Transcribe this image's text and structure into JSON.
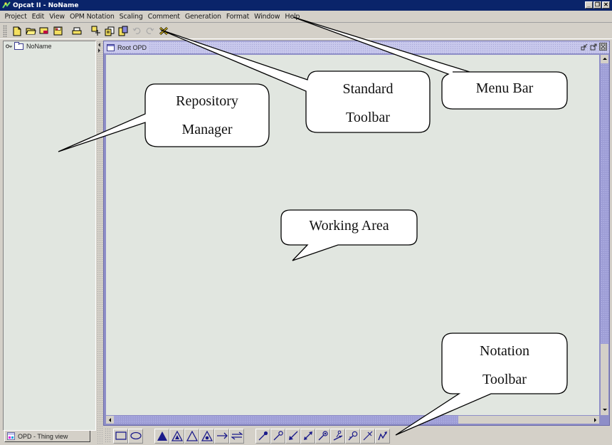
{
  "window": {
    "title": "Opcat II - NoName",
    "controls": [
      "minimize",
      "restore",
      "close"
    ]
  },
  "menubar": {
    "items": [
      "Project",
      "Edit",
      "View",
      "OPM Notation",
      "Scaling",
      "Comment",
      "Generation",
      "Format",
      "Window",
      "Help"
    ]
  },
  "standard_toolbar": {
    "buttons": [
      {
        "name": "new-project",
        "icon": "new-document-icon",
        "enabled": true
      },
      {
        "name": "open-project",
        "icon": "open-folder-icon",
        "enabled": true
      },
      {
        "name": "load-project",
        "icon": "load-icon",
        "enabled": true
      },
      {
        "name": "save-project",
        "icon": "floppy-disk-icon",
        "enabled": true
      },
      {
        "name": "print",
        "icon": "printer-icon",
        "enabled": true
      },
      {
        "name": "cut",
        "icon": "cut-icon",
        "enabled": true
      },
      {
        "name": "copy",
        "icon": "copy-icon",
        "enabled": true
      },
      {
        "name": "paste",
        "icon": "paste-icon",
        "enabled": true
      },
      {
        "name": "undo",
        "icon": "undo-icon",
        "enabled": false
      },
      {
        "name": "redo",
        "icon": "redo-icon",
        "enabled": false
      },
      {
        "name": "delete",
        "icon": "delete-x-icon",
        "enabled": true
      }
    ]
  },
  "repository": {
    "tree": [
      {
        "label": "NoName",
        "icon": "folder-icon",
        "expander": "key-icon"
      }
    ],
    "tab_label": "OPD - Thing view"
  },
  "opd_frame": {
    "title": "Root OPD",
    "controls": [
      "minimize",
      "maximize",
      "close"
    ]
  },
  "notation_toolbar": {
    "things": [
      {
        "name": "object",
        "icon": "rectangle-icon"
      },
      {
        "name": "process",
        "icon": "ellipse-icon"
      }
    ],
    "structural_links": [
      {
        "name": "aggregation",
        "icon": "filled-triangle-icon"
      },
      {
        "name": "exhibition",
        "icon": "triangle-in-triangle-icon"
      },
      {
        "name": "generalization",
        "icon": "hollow-triangle-icon"
      },
      {
        "name": "instantiation",
        "icon": "dot-triangle-icon"
      },
      {
        "name": "unidirectional-relation",
        "icon": "arrow-right-icon"
      },
      {
        "name": "bidirectional-relation",
        "icon": "bidirectional-arrow-icon"
      }
    ],
    "procedural_links": [
      {
        "name": "agent-link",
        "icon": "agent-link-icon"
      },
      {
        "name": "instrument-link",
        "icon": "instrument-link-icon"
      },
      {
        "name": "consumption-link",
        "icon": "consumption-link-icon"
      },
      {
        "name": "effect-link",
        "icon": "effect-link-icon"
      },
      {
        "name": "condition-link",
        "icon": "condition-link-icon"
      },
      {
        "name": "event-link",
        "icon": "event-link-icon"
      },
      {
        "name": "instrument-event-link",
        "icon": "instrument-event-link-icon"
      },
      {
        "name": "exception-link",
        "icon": "exception-link-icon"
      },
      {
        "name": "invocation-link",
        "icon": "invocation-link-icon"
      }
    ]
  },
  "callouts": {
    "repository_manager": [
      "Repository",
      "Manager"
    ],
    "standard_toolbar": [
      "Standard",
      "Toolbar"
    ],
    "menu_bar": [
      "Menu Bar"
    ],
    "working_area": [
      "Working Area"
    ],
    "notation_toolbar": [
      "Notation",
      "Toolbar"
    ]
  },
  "colors": {
    "titlebar": "#0a246a",
    "chrome": "#d4d0c8",
    "canvas": "#e1e6e0",
    "frame_accent": "#8e8ec8",
    "scroll_thumb": "#9e9ed6",
    "icon_blue": "#1a1a8a"
  }
}
